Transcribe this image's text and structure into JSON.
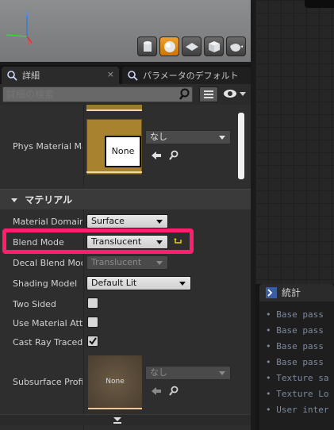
{
  "viewport": {
    "axis_z": "Z",
    "axis_x": "X"
  },
  "tabs": {
    "details_label": "詳細",
    "params_label": "パラメータのデフォルト",
    "close_glyph": "×"
  },
  "search": {
    "placeholder": "詳細の検索"
  },
  "phys_material": {
    "label": "Phys Material Ma",
    "thumbnail_text": "None",
    "combo_value": "なし"
  },
  "section": {
    "title": "マテリアル"
  },
  "props": {
    "material_domain": {
      "label": "Material Domain",
      "value": "Surface"
    },
    "blend_mode": {
      "label": "Blend Mode",
      "value": "Translucent"
    },
    "decal_blend_mode": {
      "label": "Decal Blend Mode",
      "value": "Translucent"
    },
    "shading_model": {
      "label": "Shading Model",
      "value": "Default Lit"
    },
    "two_sided": {
      "label": "Two Sided",
      "checked": false
    },
    "use_material_attributes": {
      "label": "Use Material Attri",
      "checked": false
    },
    "cast_ray_traced": {
      "label": "Cast Ray Traced S",
      "checked": true
    },
    "subsurface_profile": {
      "label": "Subsurface Profil",
      "thumbnail_text": "None",
      "combo_value": "なし"
    }
  },
  "stats": {
    "tab_label": "統計",
    "lines": [
      "Base pass",
      "Base pass",
      "Base pass",
      "Base pass",
      "Texture sa",
      "Texture Lo",
      "User inter"
    ]
  },
  "colors": {
    "highlight": "#ff1f6e",
    "accent_orange": "#e89a2a",
    "reset_arrow": "#e6d200"
  }
}
